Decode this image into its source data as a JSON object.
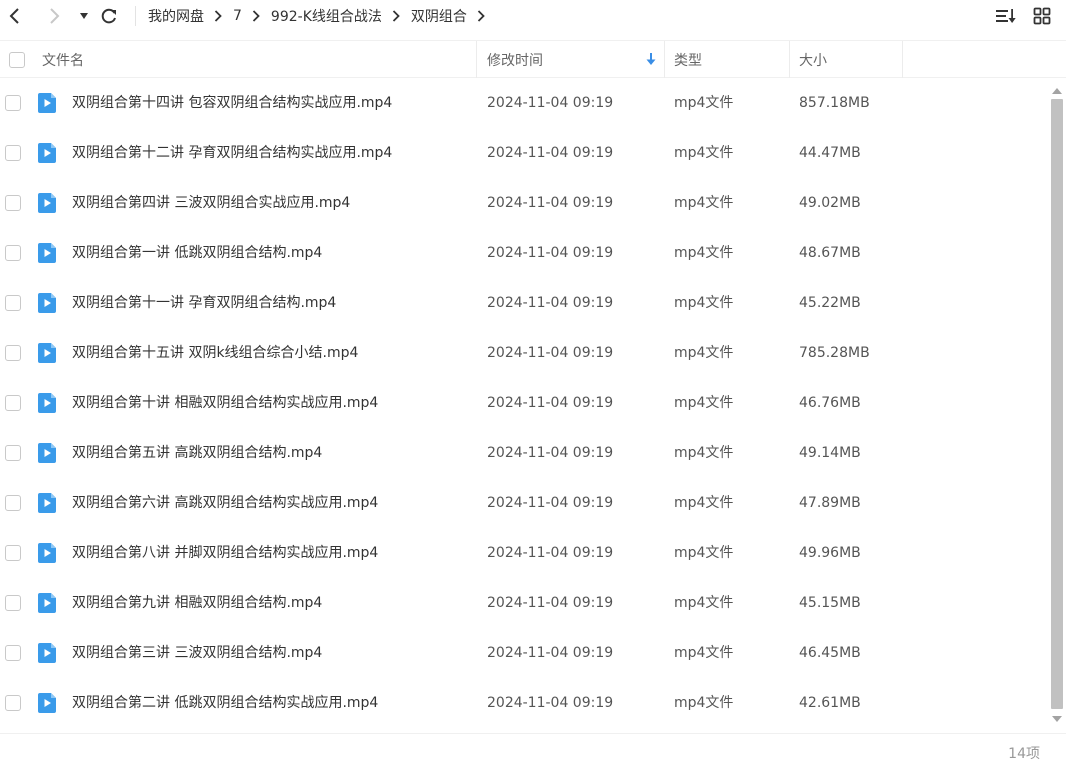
{
  "toolbar": {
    "back_icon": "chevron-left-icon",
    "forward_icon": "chevron-right-icon",
    "history_icon": "caret-down-icon",
    "refresh_icon": "refresh-icon",
    "breadcrumb": [
      "我的网盘",
      "7",
      "992-K线组合战法",
      "双阴组合"
    ],
    "sort_icon": "sort-list-icon",
    "view_icon": "grid-view-icon"
  },
  "columns": {
    "name": "文件名",
    "time": "修改时间",
    "type": "类型",
    "size": "大小"
  },
  "colors": {
    "file_icon": "#3a9bea",
    "sort_arrow": "#3a8ee6",
    "scroll_thumb": "#c1c1c1"
  },
  "files": [
    {
      "name": "双阴组合第十四讲 包容双阴组合结构实战应用.mp4",
      "time": "2024-11-04 09:19",
      "type": "mp4文件",
      "size": "857.18MB"
    },
    {
      "name": "双阴组合第十二讲 孕育双阴组合结构实战应用.mp4",
      "time": "2024-11-04 09:19",
      "type": "mp4文件",
      "size": "44.47MB"
    },
    {
      "name": "双阴组合第四讲 三波双阴组合实战应用.mp4",
      "time": "2024-11-04 09:19",
      "type": "mp4文件",
      "size": "49.02MB"
    },
    {
      "name": "双阴组合第一讲 低跳双阴组合结构.mp4",
      "time": "2024-11-04 09:19",
      "type": "mp4文件",
      "size": "48.67MB"
    },
    {
      "name": "双阴组合第十一讲 孕育双阴组合结构.mp4",
      "time": "2024-11-04 09:19",
      "type": "mp4文件",
      "size": "45.22MB"
    },
    {
      "name": "双阴组合第十五讲 双阴k线组合综合小结.mp4",
      "time": "2024-11-04 09:19",
      "type": "mp4文件",
      "size": "785.28MB"
    },
    {
      "name": "双阴组合第十讲 相融双阴组合结构实战应用.mp4",
      "time": "2024-11-04 09:19",
      "type": "mp4文件",
      "size": "46.76MB"
    },
    {
      "name": "双阴组合第五讲 高跳双阴组合结构.mp4",
      "time": "2024-11-04 09:19",
      "type": "mp4文件",
      "size": "49.14MB"
    },
    {
      "name": "双阴组合第六讲 高跳双阴组合结构实战应用.mp4",
      "time": "2024-11-04 09:19",
      "type": "mp4文件",
      "size": "47.89MB"
    },
    {
      "name": "双阴组合第八讲 并脚双阴组合结构实战应用.mp4",
      "time": "2024-11-04 09:19",
      "type": "mp4文件",
      "size": "49.96MB"
    },
    {
      "name": "双阴组合第九讲 相融双阴组合结构.mp4",
      "time": "2024-11-04 09:19",
      "type": "mp4文件",
      "size": "45.15MB"
    },
    {
      "name": "双阴组合第三讲 三波双阴组合结构.mp4",
      "time": "2024-11-04 09:19",
      "type": "mp4文件",
      "size": "46.45MB"
    },
    {
      "name": "双阴组合第二讲 低跳双阴组合结构实战应用.mp4",
      "time": "2024-11-04 09:19",
      "type": "mp4文件",
      "size": "42.61MB"
    }
  ],
  "footer": {
    "count": "14项"
  }
}
